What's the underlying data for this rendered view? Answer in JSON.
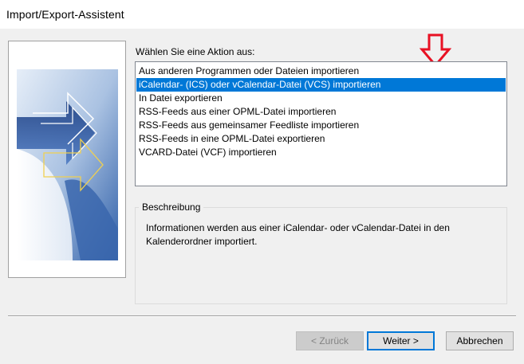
{
  "window": {
    "title": "Import/Export-Assistent"
  },
  "prompt": "Wählen Sie eine Aktion aus:",
  "actions": [
    {
      "label": "Aus anderen Programmen oder Dateien importieren",
      "selected": false
    },
    {
      "label": "iCalendar- (ICS) oder vCalendar-Datei (VCS) importieren",
      "selected": true
    },
    {
      "label": "In Datei exportieren",
      "selected": false
    },
    {
      "label": "RSS-Feeds aus einer OPML-Datei importieren",
      "selected": false
    },
    {
      "label": "RSS-Feeds aus gemeinsamer Feedliste importieren",
      "selected": false
    },
    {
      "label": "RSS-Feeds in eine OPML-Datei exportieren",
      "selected": false
    },
    {
      "label": "VCARD-Datei (VCF) importieren",
      "selected": false
    }
  ],
  "description": {
    "legend": "Beschreibung",
    "text": "Informationen werden aus einer iCalendar- oder vCalendar-Datei in den Kalenderordner importiert."
  },
  "buttons": {
    "back": "< Zurück",
    "next": "Weiter >",
    "cancel": "Abbrechen"
  },
  "colors": {
    "selection": "#0078d7",
    "annotation_arrow": "#e81123",
    "dialog_background": "#f0f0f0"
  },
  "icons": {
    "wizard_graphic": "wizard-arrows-graphic",
    "annotation": "down-arrow-icon"
  }
}
